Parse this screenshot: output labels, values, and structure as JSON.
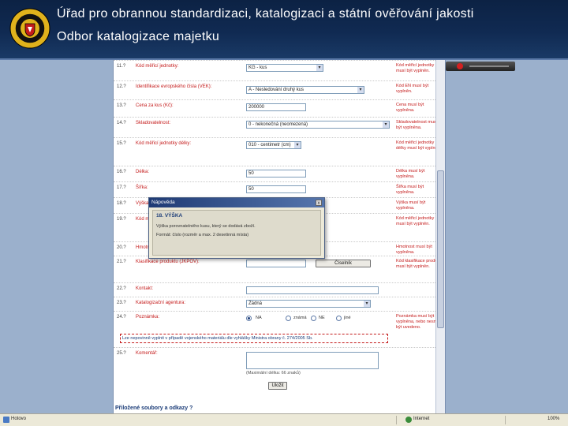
{
  "header": {
    "title": "Úřad pro obrannou standardizaci, katalogizaci a státní ověřování jakosti",
    "subtitle": "Odbor katalogizace majetku"
  },
  "form": {
    "rows": [
      {
        "num": "11.?",
        "label": "Kód měřicí jednotky:",
        "value": "KG - kus",
        "note": "Kód měřicí jednotky musí být vyplněn."
      },
      {
        "num": "12.?",
        "label": "Identifikace evropského čísla (VEK):",
        "value": "A - Nesledování druhý kus",
        "note": "Kód EN musí být vyplněn."
      },
      {
        "num": "13.?",
        "label": "Cena za kus (Kč):",
        "value": "200000",
        "note": "Cena musí být vyplněna."
      },
      {
        "num": "14.?",
        "label": "Skladovatelnost:",
        "value": "0 - nekonečná (neomezená)",
        "note": "Skladovatelnost musí být vyplněna."
      },
      {
        "num": "15.?",
        "label": "Kód měřicí jednotky délky:",
        "value": "010 - centimetr (cm)",
        "note": "Kód měřicí jednotky délky musí být vyplněn."
      },
      {
        "num": "16.?",
        "label": "Délka:",
        "value": "50",
        "note": "Délka musí být vyplněna."
      },
      {
        "num": "17.?",
        "label": "Šířka:",
        "value": "50",
        "note": "Šířka musí být vyplněna."
      },
      {
        "num": "18.?",
        "label": "Výška:",
        "value": "",
        "note": "Výška musí být vyplněna."
      },
      {
        "num": "19.?",
        "label": "Kód měřicí jednotky hmotnosti:",
        "value": "",
        "note": "Kód měřicí jednotky musí být vyplněn."
      },
      {
        "num": "20.?",
        "label": "Hmotnost:",
        "value": "",
        "note": "Hmotnost musí být vyplněna."
      },
      {
        "num": "21.?",
        "label": "Klasifikace produktu (JKPOV):",
        "value": "",
        "note": "Kód klasifikace produktu musí být vyplněn."
      },
      {
        "num": "22.?",
        "label": "Kontakt:",
        "value": "",
        "note": ""
      },
      {
        "num": "23.?",
        "label": "Katalogizační agentura:",
        "value": "Žádná",
        "note": ""
      },
      {
        "num": "24.?",
        "label": "Poznámka:",
        "value": "",
        "note": "Poznámka musí být vyplněna, nebo nesmí být uvedeno."
      },
      {
        "num": "25.?",
        "label": "Komentář:",
        "value": "",
        "note": ""
      }
    ],
    "search_button": "Číselník",
    "radios": [
      "NA",
      "známá",
      "NE",
      "jiné"
    ],
    "notice": "Lze nepovinně vyplnit v případě vojenského materiálu dle vyhlášky Ministra obrany č. 274/2005 Sb.",
    "textarea_hint": "(Maximální délka: 66 znaků)",
    "submit_button": "Uložit",
    "attachments_heading": "Přiložené soubory a odkazy ?"
  },
  "popup": {
    "title": "Nápověda",
    "close": "x",
    "heading": "18. VÝŠKA",
    "line1": "Výška porovnatelného kusu, který se dodává zboží.",
    "line2": "Formát: číslo (rozměr a max. 2 desetinná místa)"
  },
  "status": {
    "left": "Hotovo",
    "zone": "Internet",
    "zoom": "100%"
  },
  "colors": {
    "header_bg": "#102a52",
    "label_red": "#c41a1a",
    "page_bg": "#9bb0cc"
  }
}
